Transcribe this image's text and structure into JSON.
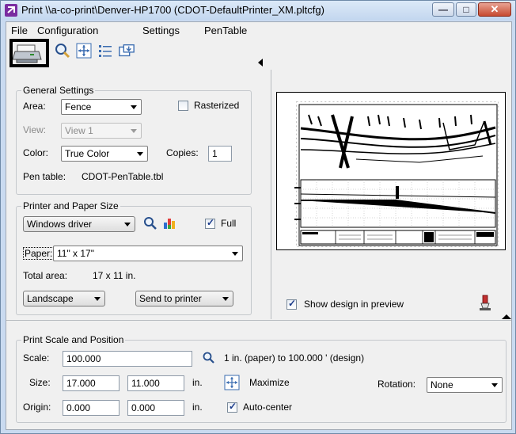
{
  "window": {
    "title": "Print  \\\\a-co-print\\Denver-HP1700  (CDOT-DefaultPrinter_XM.pltcfg)",
    "minimize_glyph": "—",
    "maximize_glyph": "□",
    "close_glyph": "✕"
  },
  "menu": {
    "file": "File",
    "configuration": "Configuration",
    "settings": "Settings",
    "pentable": "PenTable"
  },
  "toolbar": {
    "icons": [
      "printer-icon",
      "preview-zoom-icon",
      "fit-area-icon",
      "list-icon",
      "export-icon"
    ]
  },
  "general": {
    "title": "General Settings",
    "area_label": "Area:",
    "area_value": "Fence",
    "rasterized_label": "Rasterized",
    "rasterized_checked": false,
    "view_label": "View:",
    "view_value": "View 1",
    "color_label": "Color:",
    "color_value": "True Color",
    "copies_label": "Copies:",
    "copies_value": "1",
    "pentable_label": "Pen table:",
    "pentable_value": "CDOT-PenTable.tbl"
  },
  "printer": {
    "title": "Printer and Paper Size",
    "driver_value": "Windows driver",
    "full_label": "Full",
    "full_checked": true,
    "paper_label": "Paper:",
    "paper_value": "11\" x 17\"",
    "total_area_label": "Total area:",
    "total_area_value": "17 x 11 in.",
    "orientation_value": "Landscape",
    "destination_value": "Send to printer"
  },
  "preview": {
    "show_design_label": "Show design in preview",
    "show_design_checked": true
  },
  "scale": {
    "title": "Print Scale and Position",
    "scale_label": "Scale:",
    "scale_value": "100.000",
    "scale_desc": "1 in. (paper) to 100.000 ' (design)",
    "size_label": "Size:",
    "size_w": "17.000",
    "size_h": "11.000",
    "size_unit": "in.",
    "maximize_label": "Maximize",
    "rotation_label": "Rotation:",
    "rotation_value": "None",
    "origin_label": "Origin:",
    "origin_x": "0.000",
    "origin_y": "0.000",
    "origin_unit": "in.",
    "autocenter_label": "Auto-center",
    "autocenter_checked": true
  }
}
